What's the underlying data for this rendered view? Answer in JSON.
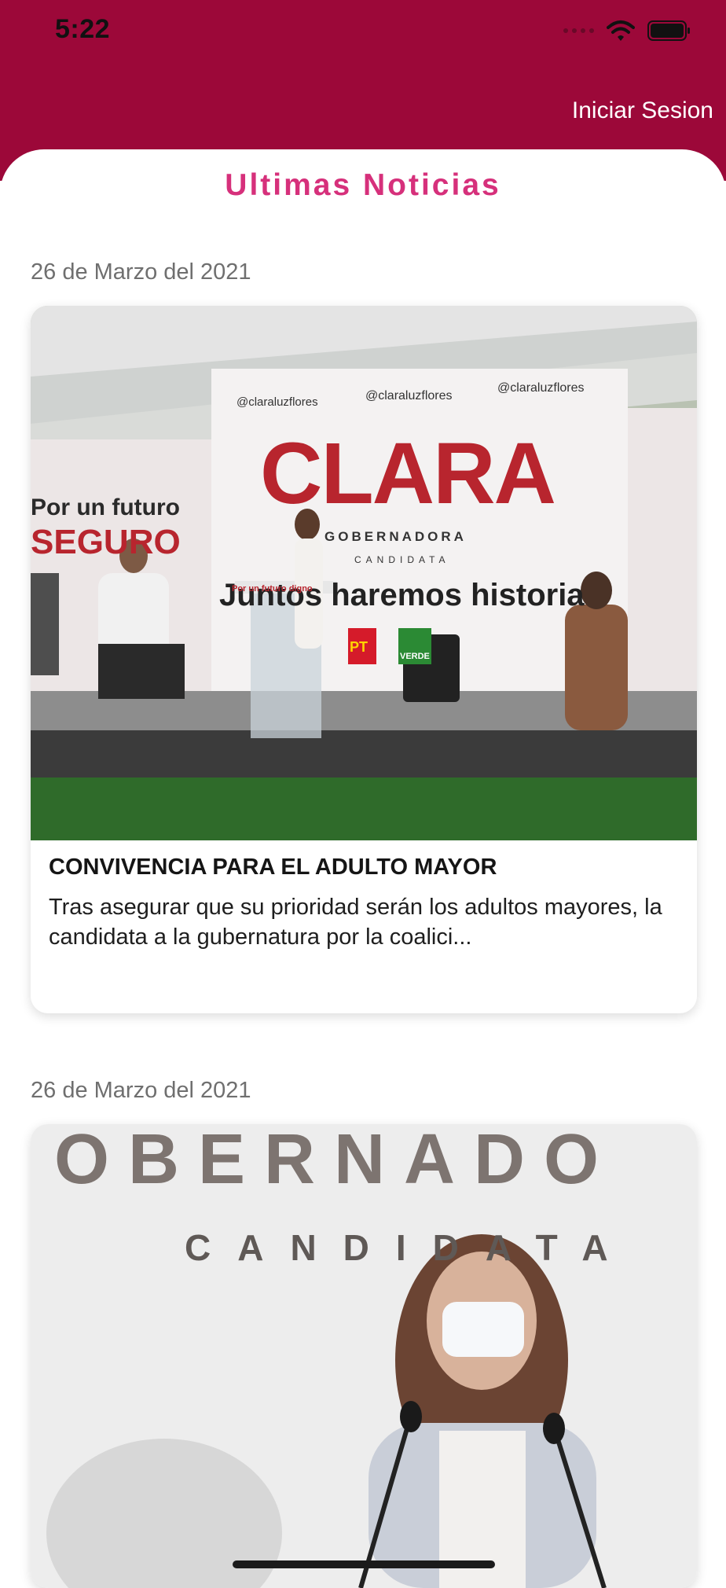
{
  "status_bar": {
    "time": "5:22"
  },
  "header": {
    "login_label": "Iniciar Sesion",
    "color": "#9c0839"
  },
  "page": {
    "title": "Ultimas Noticias",
    "title_color": "#d6307b"
  },
  "news": [
    {
      "date": "26 de Marzo del 2021",
      "title": "CONVIVENCIA PARA EL ADULTO MAYOR",
      "summary": "Tras asegurar que su prioridad serán los adultos mayores, la candidata a la gubernatura por la coalici...",
      "image": {
        "social_twitter": "@claraluzflores",
        "social_instagram": "@claraluzflores",
        "social_facebook": "@claraluzflores",
        "banner_name": "CLARA",
        "banner_role": "GOBERNADORA",
        "banner_sub": "CANDIDATA",
        "banner_slogan": "Juntos haremos historia",
        "side_slogan_1": "Por un futuro",
        "side_slogan_2": "SEGURO",
        "podium_text": "Por un futuro digno",
        "party_pt": "PT",
        "party_verde": "VERDE"
      }
    },
    {
      "date": "26 de Marzo del 2021",
      "image": {
        "banner_role": "OBERNADO",
        "banner_sub": "CANDIDATA"
      }
    }
  ]
}
